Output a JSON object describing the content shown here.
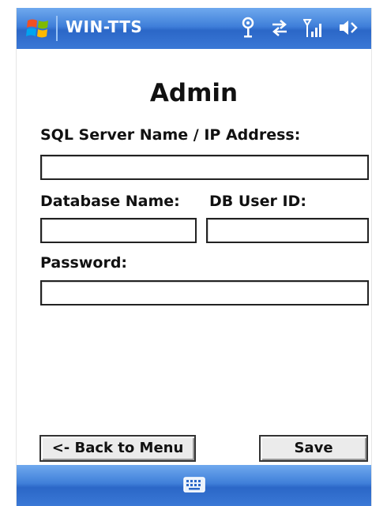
{
  "titlebar": {
    "app_title": "WIN-TTS",
    "icons": [
      "windows-start-icon",
      "antenna-icon",
      "sync-arrows-icon",
      "signal-strength-icon",
      "speaker-icon"
    ]
  },
  "form": {
    "heading": "Admin",
    "server_label": "SQL Server Name / IP Address:",
    "database_label": "Database Name:",
    "user_label": "DB User ID:",
    "password_label": "Password:",
    "server_value": "",
    "database_value": "",
    "user_value": "",
    "password_value": ""
  },
  "buttons": {
    "back_label": "<- Back to Menu",
    "save_label": "Save"
  },
  "bottombar": {
    "icons": [
      "keyboard-icon"
    ]
  },
  "colors": {
    "bar_blue": "#3f7fd9",
    "button_face": "#ebebeb"
  }
}
